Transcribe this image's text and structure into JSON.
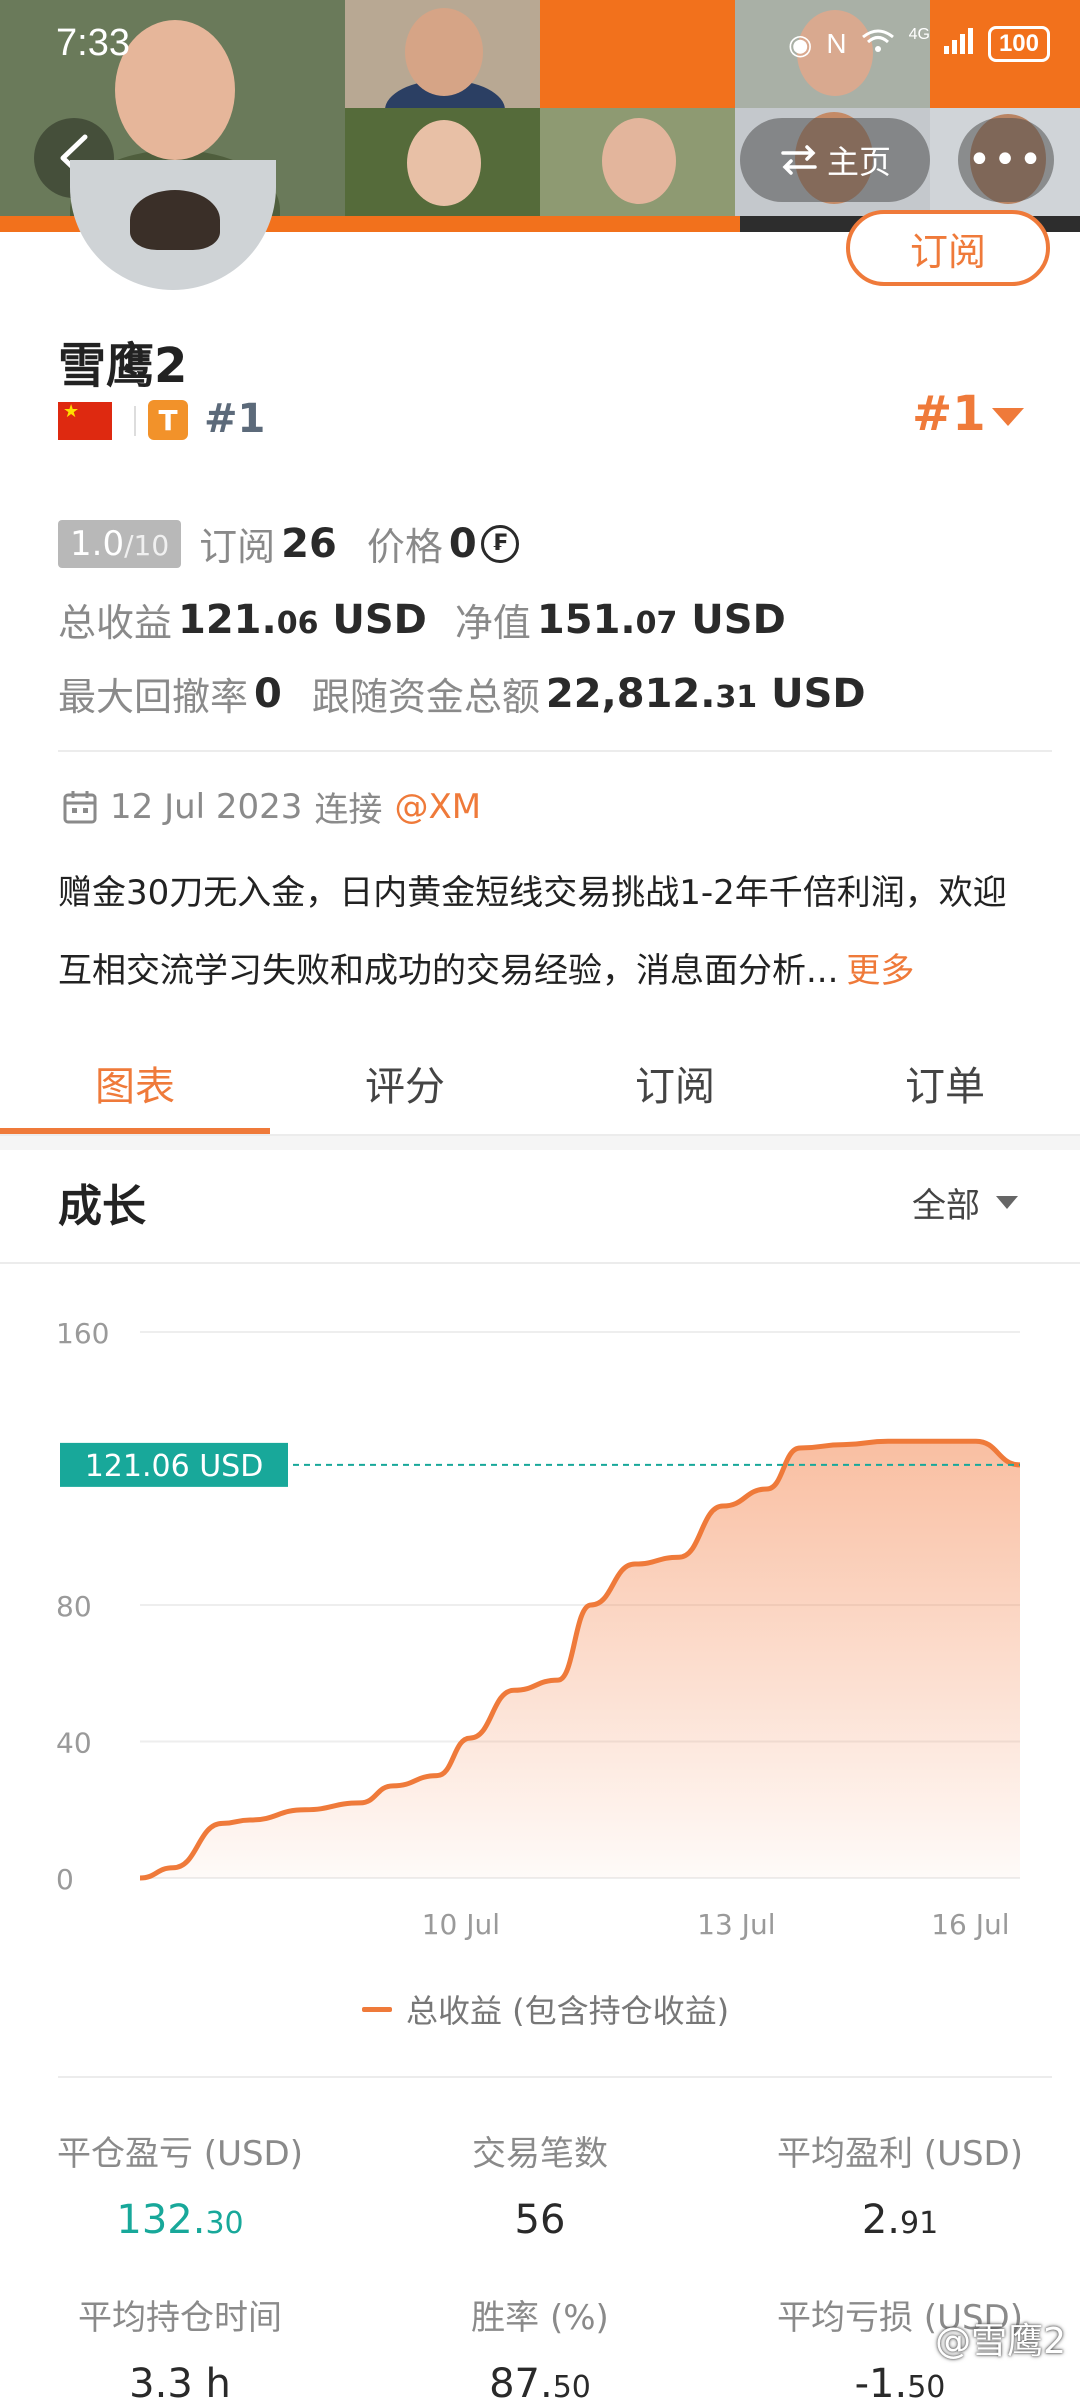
{
  "status_bar": {
    "time": "7:33",
    "network": "4G",
    "battery": "100"
  },
  "header": {
    "home_label": "主页",
    "subscribe_label": "订阅"
  },
  "profile": {
    "name": "雪鹰2",
    "rank_badge": "#1",
    "rank_large": "#1",
    "tier_badge": "T"
  },
  "stats": {
    "rating": "1.0",
    "rating_max": "/10",
    "subscribe_label": "订阅",
    "subscribe_count": "26",
    "price_label": "价格",
    "price_value": "0",
    "total_profit_label": "总收益",
    "total_profit_int": "121.",
    "total_profit_dec": "06",
    "total_profit_unit": " USD",
    "equity_label": "净值",
    "equity_int": "151.",
    "equity_dec": "07",
    "equity_unit": " USD",
    "max_drawdown_label": "最大回撤率",
    "max_drawdown_value": "0",
    "follow_funds_label": "跟随资金总额",
    "follow_funds_int": "22,812.",
    "follow_funds_dec": "31",
    "follow_funds_unit": " USD"
  },
  "connection": {
    "date": "12 Jul 2023",
    "text": "连接",
    "broker": "@XM"
  },
  "description": {
    "text": "赠金30刀无入金，日内黄金短线交易挑战1-2年千倍利润，欢迎互相交流学习失败和成功的交易经验，消息面分析...",
    "more": "更多"
  },
  "tabs": [
    {
      "label": "图表",
      "active": true
    },
    {
      "label": "评分",
      "active": false
    },
    {
      "label": "订阅",
      "active": false
    },
    {
      "label": "订单",
      "active": false
    }
  ],
  "chart_section": {
    "title": "成长",
    "range": "全部"
  },
  "chart_data": {
    "type": "area",
    "y_ticks": [
      "160",
      "80",
      "40",
      "0"
    ],
    "x_ticks": [
      "10 Jul",
      "13 Jul",
      "16 Jul"
    ],
    "ylim": [
      0,
      160
    ],
    "current_label": "121.06 USD",
    "current_value": 121.06,
    "series": [
      {
        "name": "总收益 (包含持仓收益)",
        "color": "#ef7a3a",
        "x": [
          0,
          0.3,
          0.75,
          1.0,
          1.5,
          2.0,
          2.3,
          2.7,
          3.0,
          3.4,
          3.8,
          4.1,
          4.5,
          4.9,
          5.3,
          5.7,
          6.0,
          6.4,
          6.8,
          7.2,
          7.6,
          8.0
        ],
        "values": [
          0,
          3,
          16,
          17,
          20,
          22,
          27,
          30,
          41,
          55,
          58,
          80,
          92,
          94,
          109,
          114,
          126,
          127,
          128,
          128,
          128,
          121.06
        ]
      }
    ]
  },
  "legend_label": "总收益 (包含持仓收益)",
  "metrics": [
    {
      "label": "平仓盈亏 (USD)",
      "int": "132.",
      "dec": "30",
      "positive": true
    },
    {
      "label": "交易笔数",
      "int": "56",
      "dec": "",
      "positive": false
    },
    {
      "label": "平均盈利 (USD)",
      "int": "2.",
      "dec": "91",
      "positive": false
    },
    {
      "label": "平均持仓时间",
      "int": "3.3 h",
      "dec": "",
      "positive": false
    },
    {
      "label": "胜率 (%)",
      "int": "87.",
      "dec": "50",
      "positive": false
    },
    {
      "label": "平均亏损 (USD)",
      "int": "-1.",
      "dec": "50",
      "positive": false
    }
  ],
  "watermark": "@雪鹰2"
}
